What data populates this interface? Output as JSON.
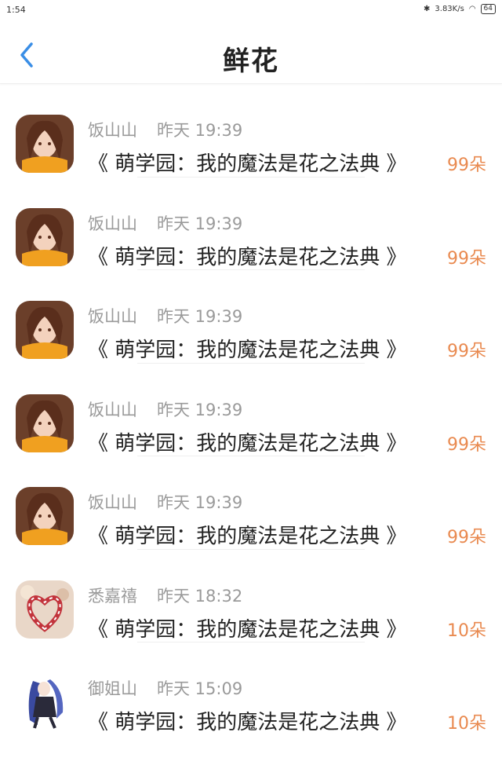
{
  "status": {
    "time": "1:54",
    "network_speed": "3.83K/s",
    "battery": "64"
  },
  "header": {
    "title": "鲜花"
  },
  "items": [
    {
      "name": "饭山山",
      "day": "昨天",
      "time": "19:39",
      "book": "《 萌学园：我的魔法是花之法典 》",
      "count": "99朵",
      "avatar": "girl-scarf"
    },
    {
      "name": "饭山山",
      "day": "昨天",
      "time": "19:39",
      "book": "《 萌学园：我的魔法是花之法典 》",
      "count": "99朵",
      "avatar": "girl-scarf"
    },
    {
      "name": "饭山山",
      "day": "昨天",
      "time": "19:39",
      "book": "《 萌学园：我的魔法是花之法典 》",
      "count": "99朵",
      "avatar": "girl-scarf"
    },
    {
      "name": "饭山山",
      "day": "昨天",
      "time": "19:39",
      "book": "《 萌学园：我的魔法是花之法典 》",
      "count": "99朵",
      "avatar": "girl-scarf"
    },
    {
      "name": "饭山山",
      "day": "昨天",
      "time": "19:39",
      "book": "《 萌学园：我的魔法是花之法典 》",
      "count": "99朵",
      "avatar": "girl-scarf"
    },
    {
      "name": "悉嘉禧",
      "day": "昨天",
      "time": "18:32",
      "book": "《 萌学园：我的魔法是花之法典 》",
      "count": "10朵",
      "avatar": "candy-hearts"
    },
    {
      "name": "御姐山",
      "day": "昨天",
      "time": "15:09",
      "book": "《 萌学园：我的魔法是花之法典 》",
      "count": "10朵",
      "avatar": "anime-character"
    }
  ],
  "colors": {
    "accent": "#3a8ee6",
    "count": "#e98a50",
    "meta": "#9a9a9a"
  }
}
